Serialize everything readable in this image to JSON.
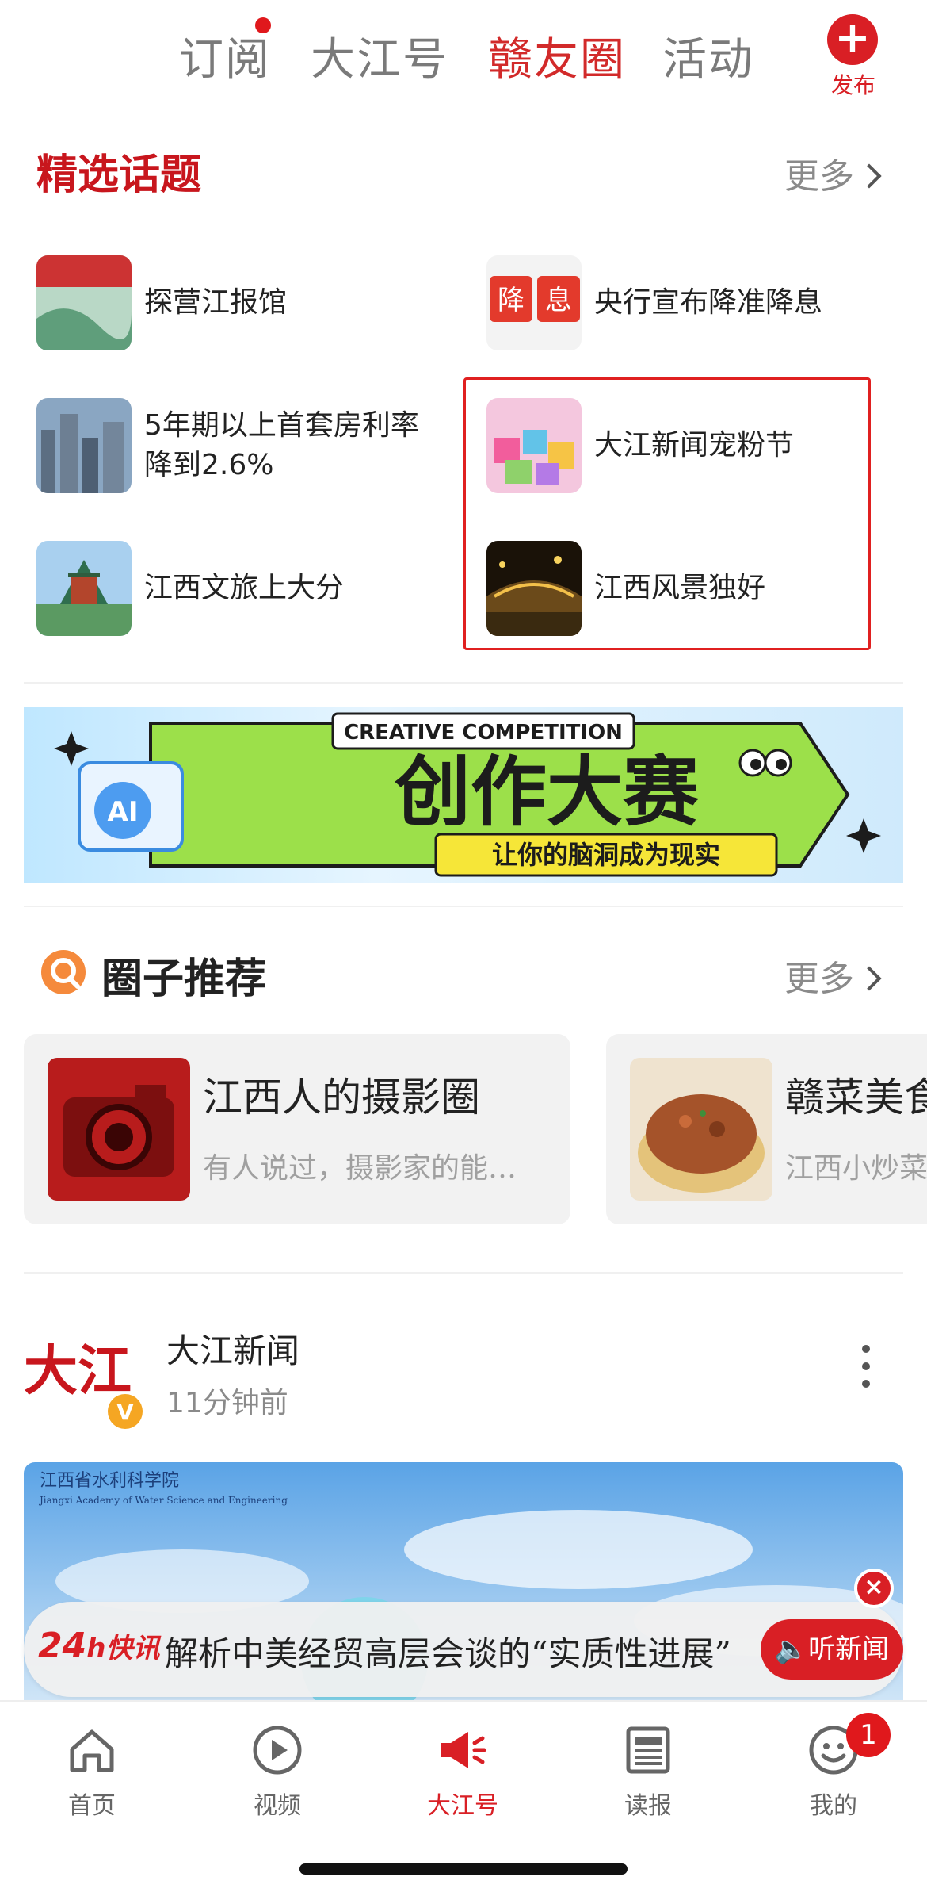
{
  "top_tabs": [
    {
      "label": "订阅",
      "active": false,
      "has_dot": true
    },
    {
      "label": "大江号",
      "active": false,
      "has_dot": false
    },
    {
      "label": "赣友圈",
      "active": true,
      "has_dot": false
    },
    {
      "label": "活动",
      "active": false,
      "has_dot": false
    }
  ],
  "publish": {
    "icon": "plus-icon",
    "label": "发布"
  },
  "featured": {
    "title": "精选话题",
    "more": "更多",
    "topics": [
      {
        "label": "探营江报馆"
      },
      {
        "label": "央行宣布降准降息",
        "thumb_text": [
          "降",
          "息"
        ]
      },
      {
        "label": "5年期以上首套房利率降到2.6%"
      },
      {
        "label": "大江新闻宠粉节"
      },
      {
        "label": "江西文旅上大分"
      },
      {
        "label": "江西风景独好"
      }
    ]
  },
  "banner": {
    "top_text": "CREATIVE COMPETITION",
    "badge_text": "AI",
    "main_text": "创作大赛",
    "sub_text": "让你的脑洞成为现实"
  },
  "circles": {
    "title": "圈子推荐",
    "icon": "search-circle-icon",
    "more": "更多",
    "items": [
      {
        "name": "江西人的摄影圈",
        "desc": "有人说过，摄影家的能…"
      },
      {
        "name": "赣菜美食",
        "desc": "江西小炒菜"
      }
    ]
  },
  "post": {
    "logo_text": "大江",
    "verified": "V",
    "author": "大江新闻",
    "time": "11分钟前",
    "image_caption": "江西省水利科学院",
    "image_caption_en": "Jiangxi Academy of Water Science and Engineering"
  },
  "ticker": {
    "logo_num": "24",
    "logo_unit": "h",
    "logo_word": "快讯",
    "text": "解析中美经贸高层会谈的“实质性进展”",
    "listen": "听新闻"
  },
  "bottom_nav": [
    {
      "label": "首页",
      "icon": "home-icon",
      "active": false
    },
    {
      "label": "视频",
      "icon": "play-icon",
      "active": false
    },
    {
      "label": "大江号",
      "icon": "megaphone-icon",
      "active": true
    },
    {
      "label": "读报",
      "icon": "newspaper-icon",
      "active": false
    },
    {
      "label": "我的",
      "icon": "smiley-icon",
      "active": false,
      "badge": "1"
    }
  ],
  "colors": {
    "accent": "#d91f25",
    "muted": "#8a8a8a"
  }
}
